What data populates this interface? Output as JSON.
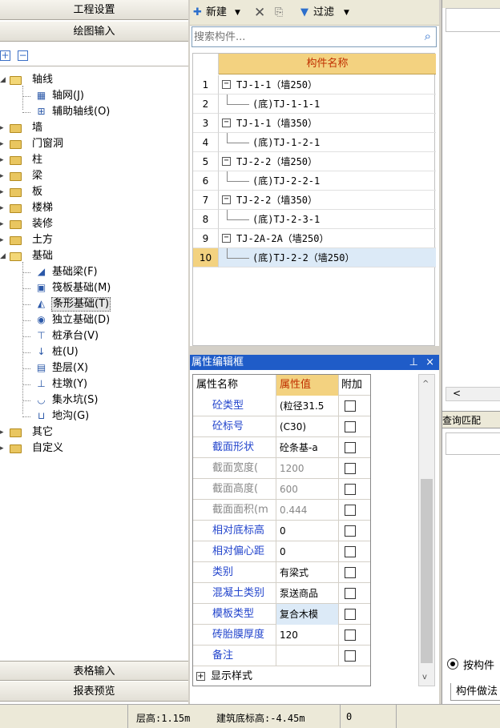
{
  "left_panel": {
    "tab_project_settings": "工程设置",
    "tab_drawing_input": "绘图输入",
    "tab_table_input": "表格输入",
    "tab_report_preview": "报表预览",
    "tree": [
      {
        "label": "轴线",
        "kind": "folder-open",
        "level": 0
      },
      {
        "label": "轴网(J)",
        "kind": "leaf",
        "icon": "grid-icon",
        "level": 1
      },
      {
        "label": "辅助轴线(O)",
        "kind": "leaf",
        "icon": "aux-grid-icon",
        "level": 1
      },
      {
        "label": "墙",
        "kind": "folder",
        "level": 0
      },
      {
        "label": "门窗洞",
        "kind": "folder",
        "level": 0
      },
      {
        "label": "柱",
        "kind": "folder",
        "level": 0
      },
      {
        "label": "梁",
        "kind": "folder",
        "level": 0
      },
      {
        "label": "板",
        "kind": "folder",
        "level": 0
      },
      {
        "label": "楼梯",
        "kind": "folder",
        "level": 0
      },
      {
        "label": "装修",
        "kind": "folder",
        "level": 0
      },
      {
        "label": "土方",
        "kind": "folder",
        "level": 0
      },
      {
        "label": "基础",
        "kind": "folder-open",
        "level": 0
      },
      {
        "label": "基础梁(F)",
        "kind": "leaf",
        "icon": "foundation-beam-icon",
        "level": 1
      },
      {
        "label": "筏板基础(M)",
        "kind": "leaf",
        "icon": "raft-foundation-icon",
        "level": 1
      },
      {
        "label": "条形基础(T)",
        "kind": "leaf",
        "icon": "strip-foundation-icon",
        "level": 1,
        "selected": true
      },
      {
        "label": "独立基础(D)",
        "kind": "leaf",
        "icon": "isolated-foundation-icon",
        "level": 1
      },
      {
        "label": "桩承台(V)",
        "kind": "leaf",
        "icon": "pile-cap-icon",
        "level": 1
      },
      {
        "label": "桩(U)",
        "kind": "leaf",
        "icon": "pile-icon",
        "level": 1
      },
      {
        "label": "垫层(X)",
        "kind": "leaf",
        "icon": "cushion-icon",
        "level": 1
      },
      {
        "label": "柱墩(Y)",
        "kind": "leaf",
        "icon": "column-pier-icon",
        "level": 1
      },
      {
        "label": "集水坑(S)",
        "kind": "leaf",
        "icon": "sump-pit-icon",
        "level": 1
      },
      {
        "label": "地沟(G)",
        "kind": "leaf",
        "icon": "trench-icon",
        "level": 1
      },
      {
        "label": "其它",
        "kind": "folder",
        "level": 0
      },
      {
        "label": "自定义",
        "kind": "folder",
        "level": 0
      }
    ]
  },
  "toolbar": {
    "new_label": "新建",
    "filter_label": "过滤"
  },
  "search": {
    "placeholder": "搜索构件..."
  },
  "component_list": {
    "header": "构件名称",
    "rows": [
      {
        "num": "1",
        "name": "TJ-1-1（墙250）",
        "child": false
      },
      {
        "num": "2",
        "name": "(底)TJ-1-1-1",
        "child": true
      },
      {
        "num": "3",
        "name": "TJ-1-1（墙350）",
        "child": false
      },
      {
        "num": "4",
        "name": "(底)TJ-1-2-1",
        "child": true
      },
      {
        "num": "5",
        "name": "TJ-2-2（墙250）",
        "child": false
      },
      {
        "num": "6",
        "name": "(底)TJ-2-2-1",
        "child": true
      },
      {
        "num": "7",
        "name": "TJ-2-2（墙350）",
        "child": false
      },
      {
        "num": "8",
        "name": "(底)TJ-2-3-1",
        "child": true
      },
      {
        "num": "9",
        "name": "TJ-2A-2A（墙250）",
        "child": false
      },
      {
        "num": "10",
        "name": "(底)TJ-2-2（墙250）",
        "child": true,
        "selected": true
      }
    ]
  },
  "property_panel": {
    "title": "属性编辑框",
    "col_name": "属性名称",
    "col_value": "属性值",
    "col_extra": "附加",
    "rows": [
      {
        "name": "砼类型",
        "value": "(粒径31.5",
        "enabled": true
      },
      {
        "name": "砼标号",
        "value": "(C30)",
        "enabled": true
      },
      {
        "name": "截面形状",
        "value": "砼条基-a",
        "enabled": true
      },
      {
        "name": "截面宽度(",
        "value": "1200",
        "enabled": false
      },
      {
        "name": "截面高度(",
        "value": "600",
        "enabled": false
      },
      {
        "name": "截面面积(m",
        "value": "0.444",
        "enabled": false
      },
      {
        "name": "相对底标高",
        "value": "0",
        "enabled": true
      },
      {
        "name": "相对偏心距",
        "value": "0",
        "enabled": true
      },
      {
        "name": "类别",
        "value": "有梁式",
        "enabled": true
      },
      {
        "name": "混凝土类别",
        "value": "泵送商品",
        "enabled": true
      },
      {
        "name": "模板类型",
        "value": "复合木模",
        "enabled": true,
        "highlight": true
      },
      {
        "name": "砖胎膜厚度",
        "value": "120",
        "enabled": true
      },
      {
        "name": "备注",
        "value": "",
        "enabled": true
      }
    ],
    "show_style": "显示样式"
  },
  "right_panel": {
    "query_title": "查询匹配",
    "radio_label": "按构件",
    "tab_label": "构件做法"
  },
  "status_bar": {
    "floor_height": "层高:1.15m",
    "base_elevation": "建筑底标高:-4.45m",
    "extra": "0"
  }
}
